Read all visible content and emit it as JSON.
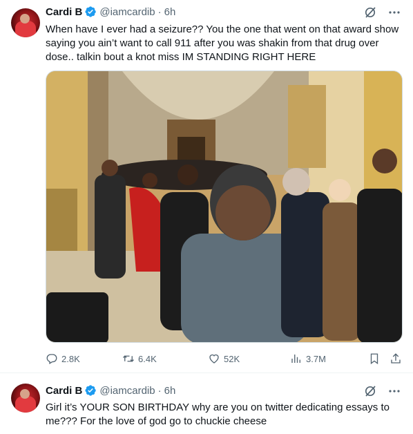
{
  "tweets": [
    {
      "name": "Cardi B",
      "handle": "@iamcardib",
      "sep": "·",
      "time": "6h",
      "text": "When have I ever had a seizure?? You the one that went on that award show saying you ain’t want to call 911 after you was shakin from that drug over dose.. talkin bout a knot miss IM STANDING RIGHT HERE",
      "actions": {
        "replies": "2.8K",
        "reposts": "6.4K",
        "likes": "52K",
        "views": "3.7M"
      }
    },
    {
      "name": "Cardi B",
      "handle": "@iamcardib",
      "sep": "·",
      "time": "6h",
      "text": "Girl it’s YOUR SON BIRTHDAY why are you on twitter dedicating essays to me??? For the love of god go to chuckie cheese"
    }
  ],
  "icons": {
    "verified": "verified-badge-icon",
    "grok": "grok-slash-icon",
    "more": "more-horizontal-icon",
    "reply": "reply-icon",
    "repost": "repost-icon",
    "like": "heart-icon",
    "views": "views-bar-icon",
    "bookmark": "bookmark-icon",
    "share": "share-icon"
  },
  "colors": {
    "verified": "#1d9bf0",
    "secondary_text": "#536471",
    "primary_text": "#0f1419"
  }
}
